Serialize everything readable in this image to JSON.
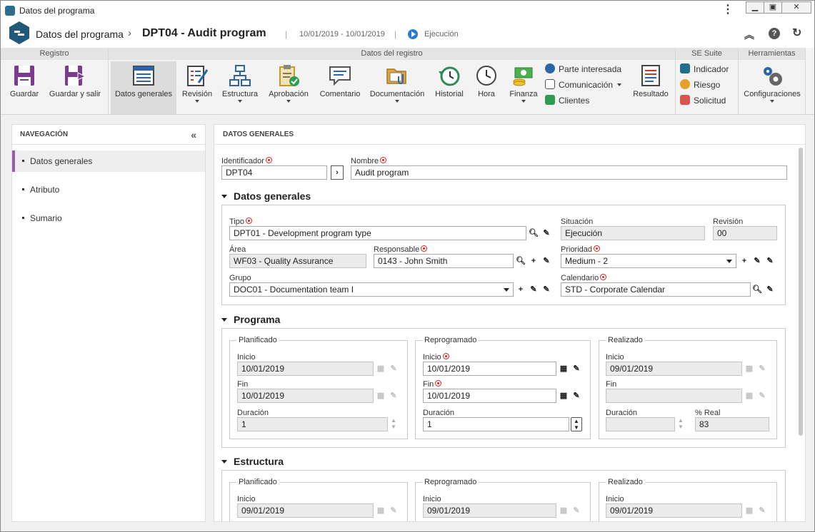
{
  "window": {
    "title": "Datos del programa"
  },
  "header": {
    "crumb1": "Datos del programa",
    "crumb2": "DPT04 - Audit program",
    "dates": "10/01/2019 - 10/01/2019",
    "status": "Ejecución"
  },
  "ribbon": {
    "groups": {
      "registro": "Registro",
      "datos": "Datos del registro",
      "suite": "SE Suite",
      "herramientas": "Herramientas"
    },
    "guardar": "Guardar",
    "guardar_salir": "Guardar y salir",
    "datos_generales": "Datos generales",
    "revision": "Revisión",
    "estructura": "Estructura",
    "aprobacion": "Aprobación",
    "comentario": "Comentario",
    "documentacion": "Documentación",
    "historial": "Historial",
    "hora": "Hora",
    "finanza": "Finanza",
    "parte": "Parte interesada",
    "comunicacion": "Comunicación",
    "clientes": "Clientes",
    "resultado": "Resultado",
    "indicador": "Indicador",
    "riesgo": "Riesgo",
    "solicitud": "Solicitud",
    "configuraciones": "Configuraciones"
  },
  "nav": {
    "title": "NAVEGACIÓN",
    "items": [
      "Datos generales",
      "Atributo",
      "Sumario"
    ]
  },
  "main": {
    "title": "DATOS GENERALES",
    "identificador_label": "Identificador",
    "identificador": "DPT04",
    "nombre_label": "Nombre",
    "nombre": "Audit program",
    "sec_general": "Datos generales",
    "tipo_label": "Tipo",
    "tipo": "DPT01 - Development program type",
    "situacion_label": "Situación",
    "situacion": "Ejecución",
    "revision_label": "Revisión",
    "revision": "00",
    "area_label": "Área",
    "area": "WF03 - Quality Assurance",
    "responsable_label": "Responsable",
    "responsable": "0143 - John Smith",
    "prioridad_label": "Prioridad",
    "prioridad": "Medium - 2",
    "grupo_label": "Grupo",
    "grupo": "DOC01 - Documentation team I",
    "calendario_label": "Calendario",
    "calendario": "STD - Corporate Calendar",
    "sec_programa": "Programa",
    "planificado": "Planificado",
    "reprogramado": "Reprogramado",
    "realizado": "Realizado",
    "inicio": "Inicio",
    "fin": "Fin",
    "duracion": "Duración",
    "real": "% Real",
    "prog": {
      "plan_inicio": "10/01/2019",
      "plan_fin": "10/01/2019",
      "plan_dur": "1",
      "rep_inicio": "10/01/2019",
      "rep_fin": "10/01/2019",
      "rep_dur": "1",
      "real_inicio": "09/01/2019",
      "real_fin": "",
      "real_dur": "",
      "real_pct": "83"
    },
    "sec_estructura": "Estructura",
    "estr": {
      "plan_inicio": "09/01/2019",
      "rep_inicio": "09/01/2019",
      "real_inicio": "09/01/2019"
    }
  }
}
